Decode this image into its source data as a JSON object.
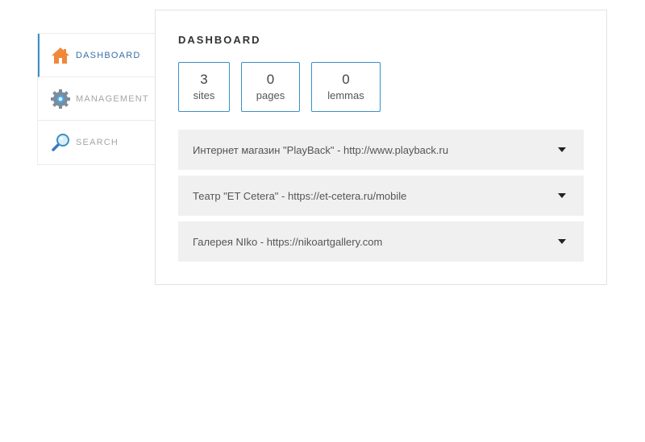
{
  "sidebar": {
    "items": [
      {
        "label": "DASHBOARD",
        "icon": "home-icon",
        "active": true
      },
      {
        "label": "MANAGEMENT",
        "icon": "gear-icon",
        "active": false
      },
      {
        "label": "SEARCH",
        "icon": "magnifier-icon",
        "active": false
      }
    ]
  },
  "main": {
    "title": "DASHBOARD",
    "stats": [
      {
        "value": "3",
        "label": "sites"
      },
      {
        "value": "0",
        "label": "pages"
      },
      {
        "value": "0",
        "label": "lemmas"
      }
    ],
    "sites": [
      {
        "label": "Интернет магазин \"PlayBack\" - http://www.playback.ru"
      },
      {
        "label": "Театр \"ET Cetera\" - https://et-cetera.ru/mobile"
      },
      {
        "label": "Галерея NIko - https://nikoartgallery.com"
      }
    ]
  },
  "colors": {
    "accent": "#3a8fc7",
    "active_text": "#3a6ea5",
    "home_icon": "#f0883a",
    "row_bg": "#f0f0f0"
  }
}
